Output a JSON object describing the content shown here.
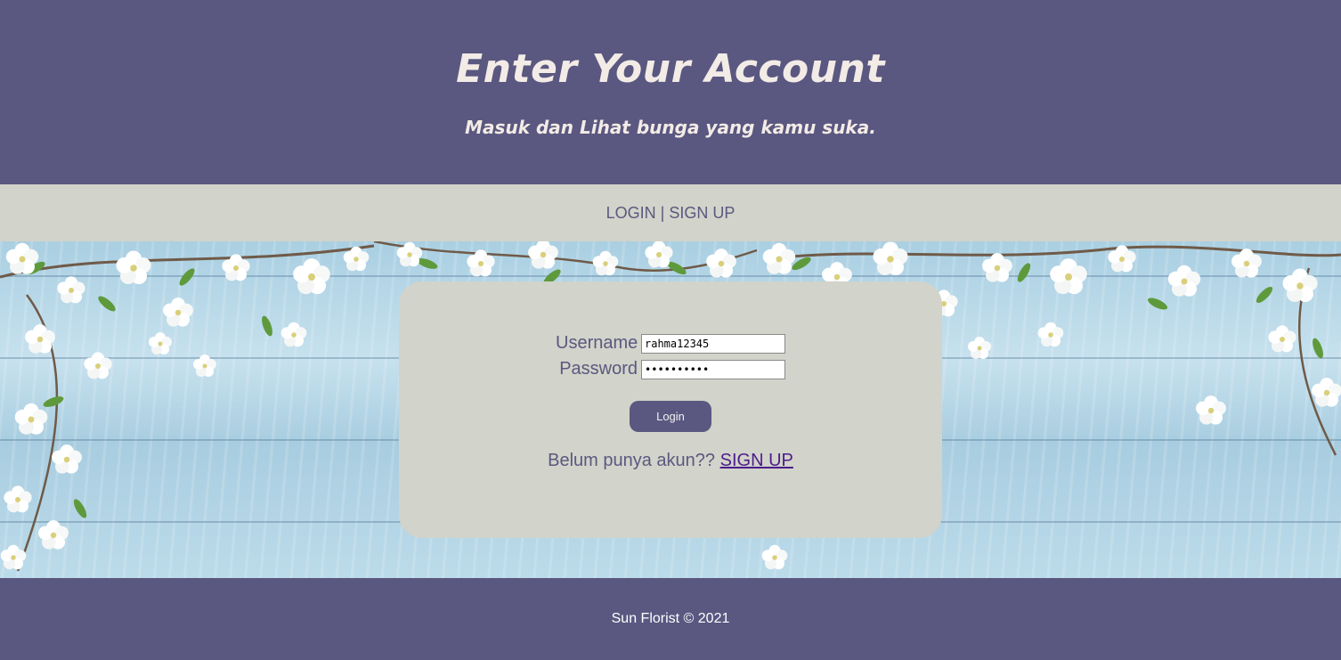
{
  "header": {
    "title": "Enter Your Account",
    "subtitle": "Masuk dan Lihat bunga yang kamu suka."
  },
  "nav": {
    "login": "LOGIN",
    "separator": "|",
    "signup": "SIGN UP"
  },
  "form": {
    "username_label": "Username",
    "username_value": "rahma12345",
    "password_label": "Password",
    "password_value": "rahma12345",
    "login_button": "Login",
    "signup_prompt": "Belum punya akun??",
    "signup_link": "SIGN UP"
  },
  "footer": {
    "text": "Sun Florist © 2021"
  },
  "colors": {
    "primary": "#5a5880",
    "panel": "#d2d3ca",
    "link": "#4b1d8c"
  },
  "background": {
    "image": "white cherry blossoms on light blue wooden planks"
  }
}
